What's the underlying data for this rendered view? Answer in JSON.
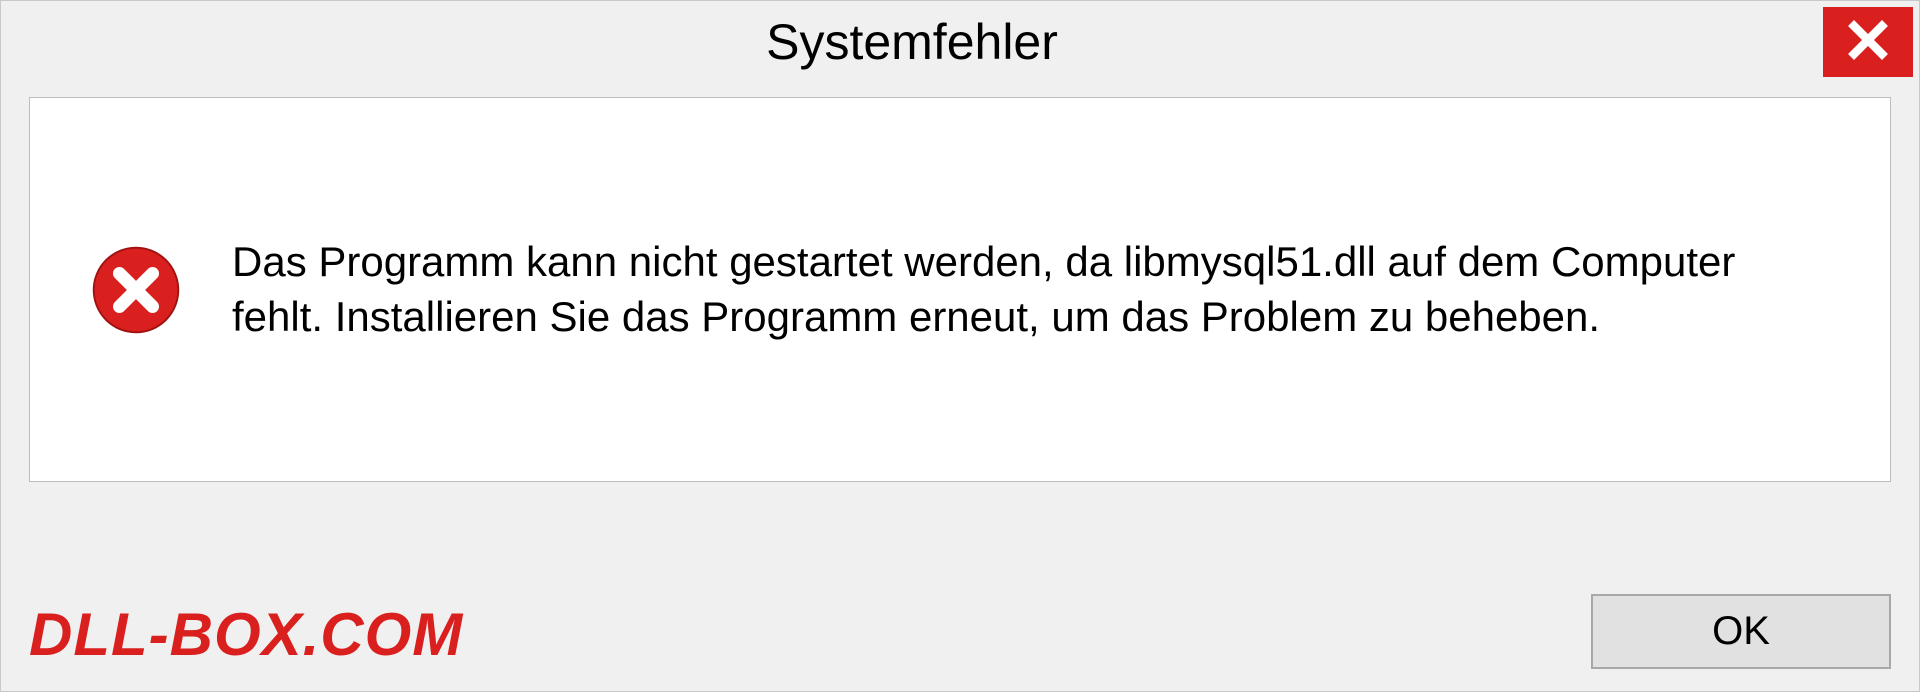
{
  "dialog": {
    "title": "Systemfehler",
    "message": "Das Programm kann nicht gestartet werden, da libmysql51.dll auf dem Computer fehlt. Installieren Sie das Programm erneut, um das Problem zu beheben.",
    "ok_label": "OK"
  },
  "watermark": "DLL-BOX.COM"
}
